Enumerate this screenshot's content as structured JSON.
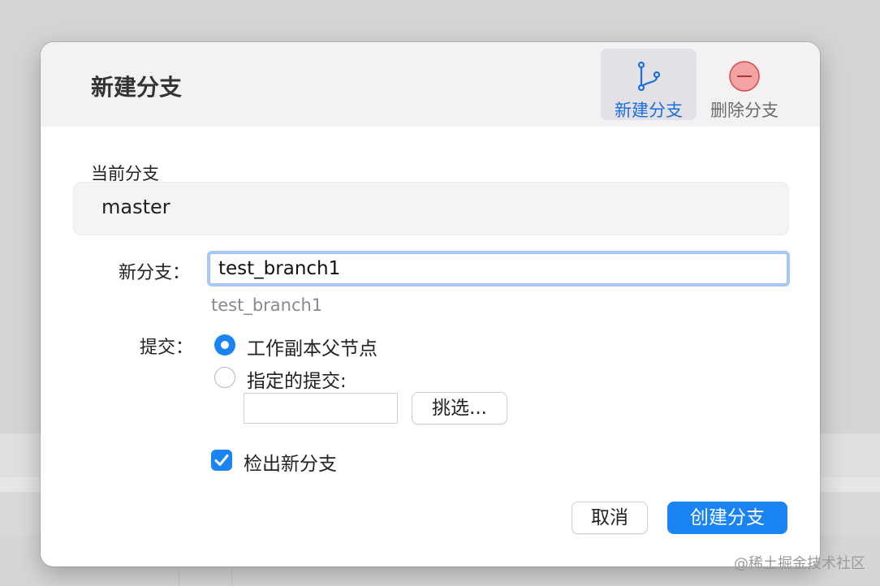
{
  "dialog": {
    "title": "新建分支",
    "toolbar": {
      "new_branch": {
        "label": "新建分支",
        "icon": "branch-icon"
      },
      "delete_branch": {
        "label": "删除分支",
        "icon": "minus-circle-icon"
      }
    },
    "current_branch": {
      "label": "当前分支",
      "value": "master"
    },
    "new_branch_field": {
      "label": "新分支：",
      "value": "test_branch1",
      "hint": "test_branch1"
    },
    "commit": {
      "label": "提交：",
      "options": [
        {
          "label": "工作副本父节点",
          "selected": true
        },
        {
          "label": "指定的提交:",
          "selected": false
        }
      ],
      "specified_value": "",
      "pick_button": "挑选..."
    },
    "checkout": {
      "label": "检出新分支",
      "checked": true
    },
    "buttons": {
      "cancel": "取消",
      "create": "创建分支"
    }
  },
  "watermark": "@稀土掘金技术社区",
  "colors": {
    "accent": "#1a84f5",
    "delete_icon": "#f4a3a3"
  }
}
